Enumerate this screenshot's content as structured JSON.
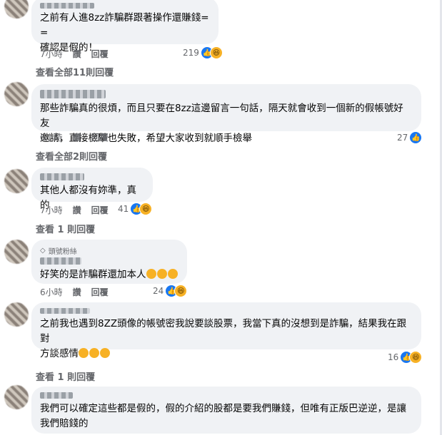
{
  "comments": [
    {
      "text": "之前有人進8zz詐騙群跟著操作還賺錢= =\n確認是假的！",
      "time": "7小時",
      "like": "讚",
      "reply": "回覆",
      "reaction_count": "219",
      "reactions": [
        "like-icon",
        "haha-icon"
      ],
      "view_replies": "查看全部11則回覆"
    },
    {
      "text": "那些詐騙真的很煩，而且只要在8zz這邊留言一句話，隔天就會收到一個新的假帳號好友\n邀請，直接檢舉也失敗，希望大家收到就順手檢舉",
      "time": "6小時",
      "like": "讚",
      "reply": "回覆",
      "reaction_count": "27",
      "reactions": [
        "like-icon"
      ],
      "view_replies": "查看全部2則回覆"
    },
    {
      "text": "其他人都沒有妳準，真的",
      "time": "7小時",
      "like": "讚",
      "reply": "回覆",
      "reaction_count": "41",
      "reactions": [
        "like-icon",
        "haha-icon"
      ],
      "view_replies": "查看 1 則回覆"
    },
    {
      "badge": "頭號粉絲",
      "text": "好笑的是詐騙群還加本人",
      "time": "6小時",
      "like": "讚",
      "reply": "回覆",
      "reaction_count": "24",
      "reactions": [
        "like-icon",
        "haha-icon"
      ],
      "view_replies": ""
    },
    {
      "text": "之前我也遇到8ZZ頭像的帳號密我說要談股票，我當下真的沒想到是詐騙，結果我在跟對\n方談感情",
      "time": "6小時",
      "like": "讚",
      "reply": "回覆",
      "reaction_count": "16",
      "reactions": [
        "like-icon",
        "haha-icon"
      ],
      "view_replies": "查看 1 則回覆"
    },
    {
      "text": "我們可以確定這些都是假的，假的介紹的股都是要我們賺錢，但唯有正版巴逆逆，是讓\n我們賠錢的",
      "time": "",
      "like": "",
      "reply": "",
      "reaction_count": "",
      "reactions": [],
      "view_replies": ""
    }
  ]
}
